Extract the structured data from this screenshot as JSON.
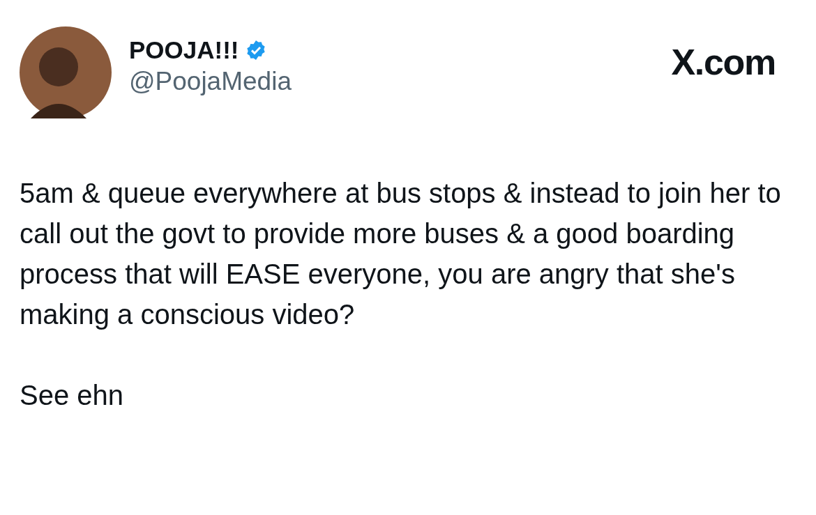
{
  "author": {
    "name": "POOJA!!!",
    "verified": true,
    "handle": "@PoojaMedia"
  },
  "site_label": "X.com",
  "paragraphs": [
    "5am & queue everywhere at bus stops & instead to join her to call out the govt to provide more buses & a good boarding process that will EASE everyone, you are angry that she's making a conscious video?",
    "See ehn"
  ]
}
